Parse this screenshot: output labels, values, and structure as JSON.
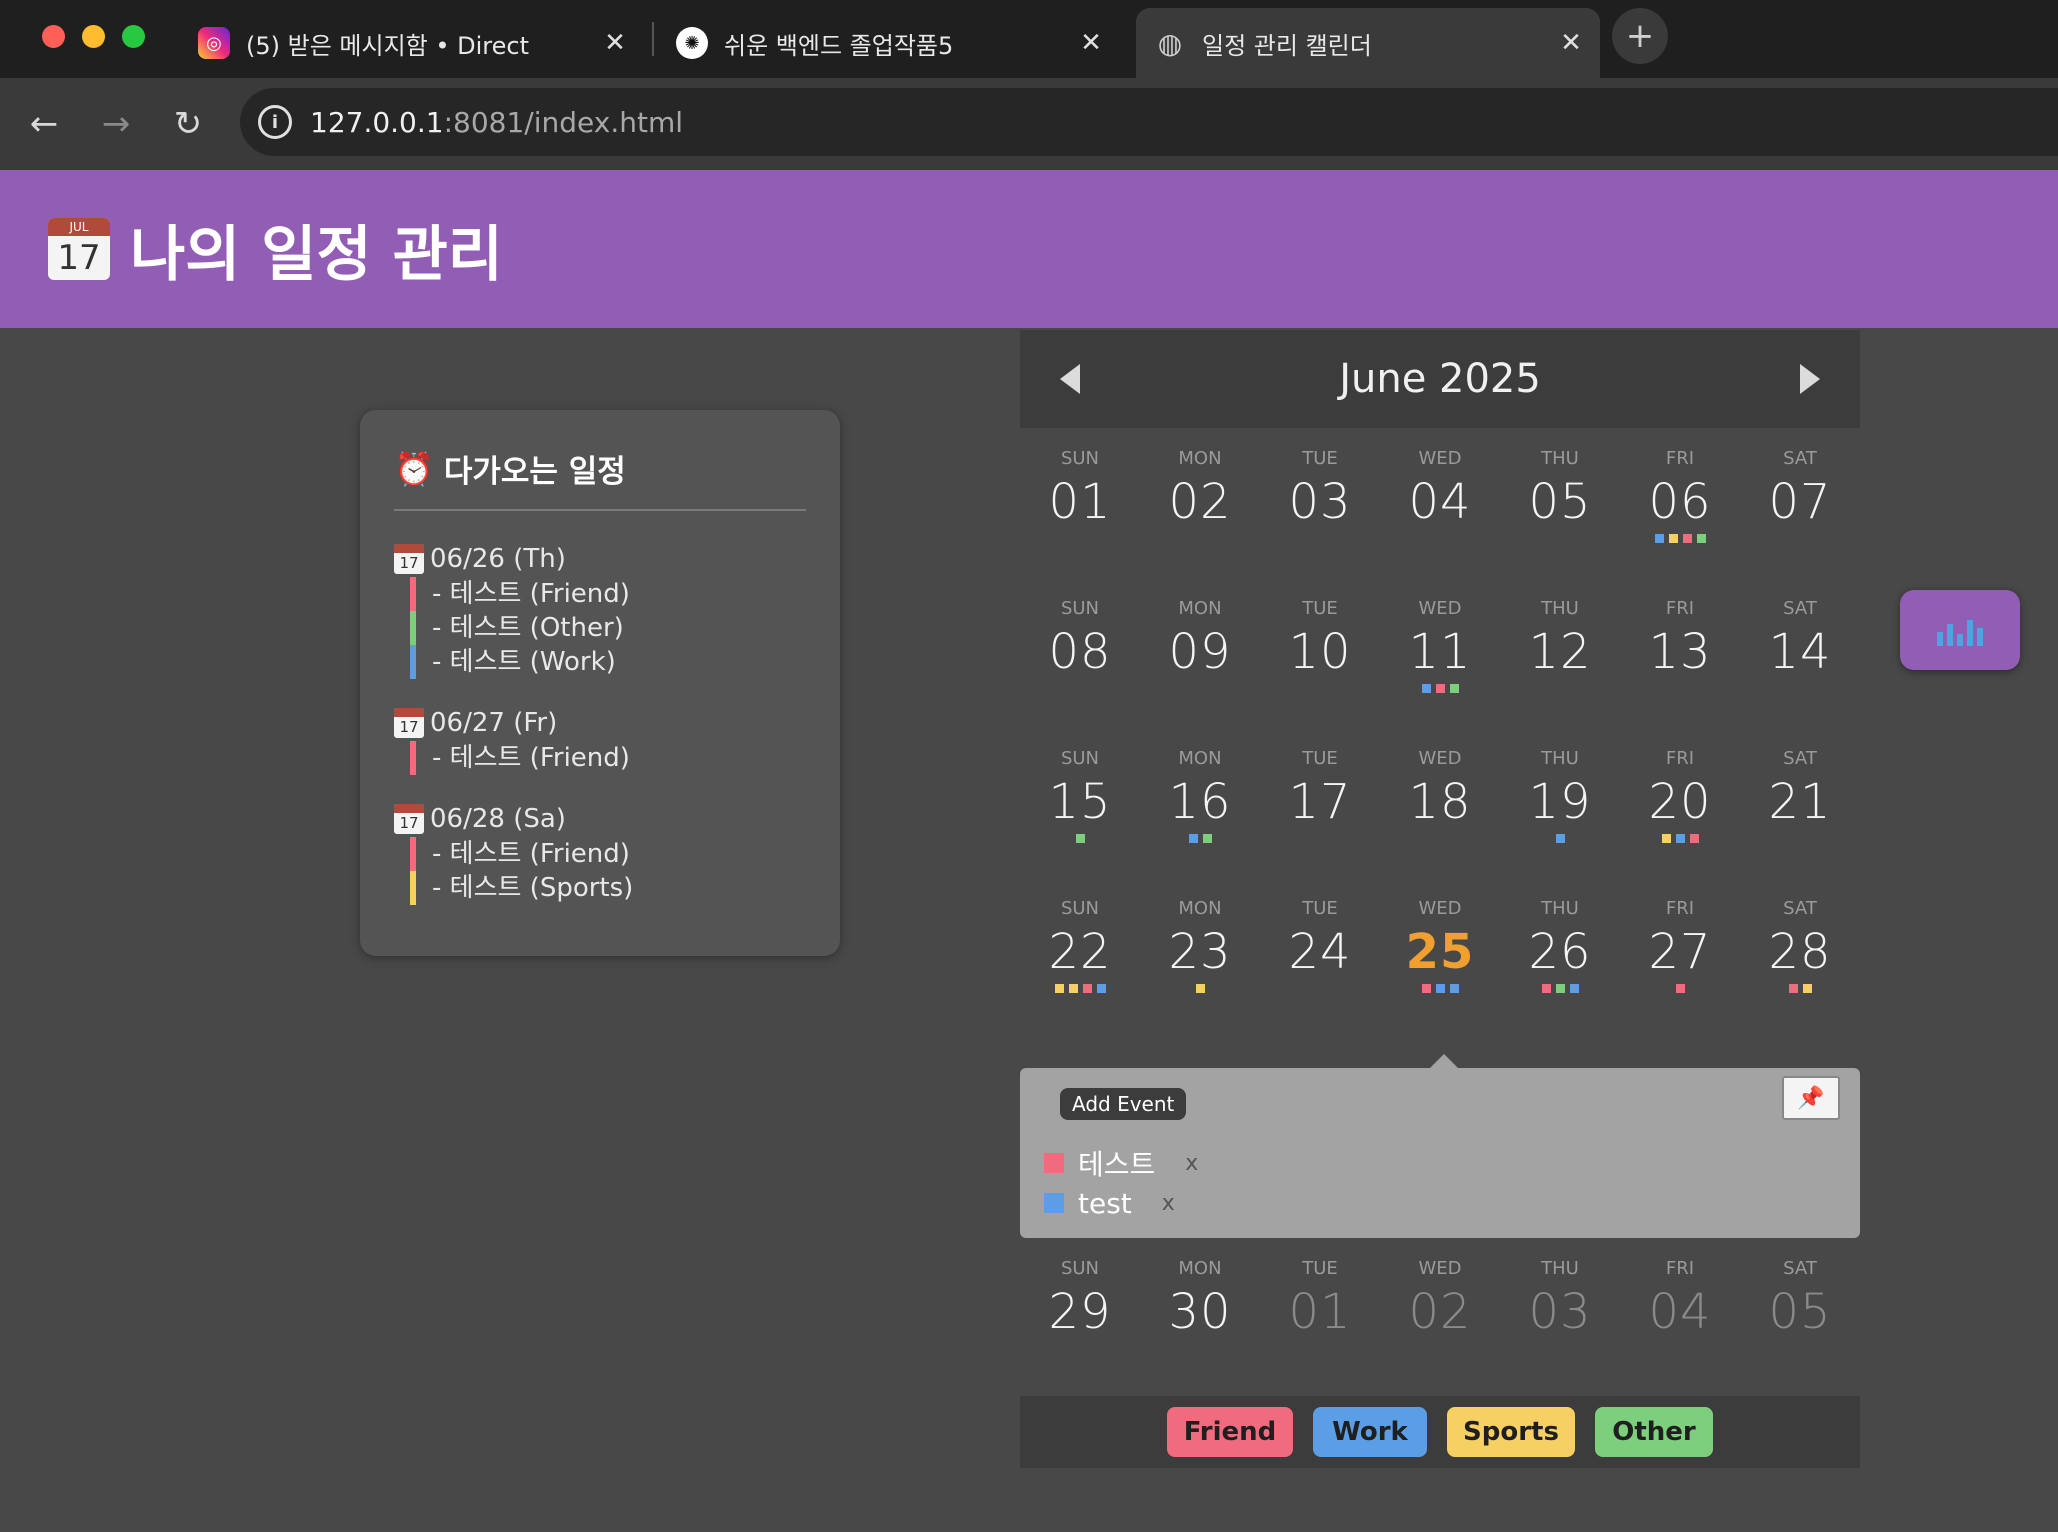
{
  "browser": {
    "tabs": [
      {
        "title": "(5) 받은 메시지함 • Direct",
        "icon": "instagram-icon",
        "close": "✕"
      },
      {
        "title": "쉬운 백엔드 졸업작품5",
        "icon": "chatgpt-icon",
        "close": "✕"
      },
      {
        "title": "일정 관리 캘린더",
        "icon": "globe-icon",
        "close": "✕"
      }
    ],
    "new_tab": "+",
    "url_host": "127.0.0.1",
    "url_path": ":8081/index.html"
  },
  "header": {
    "icon_month": "JUL",
    "icon_day": "17",
    "title": "나의 일정 관리"
  },
  "upcoming": {
    "title": "다가오는 일정",
    "groups": [
      {
        "date": "06/26 (Th)",
        "items": [
          {
            "text": "- 테스트 (Friend)",
            "color": "#f06b7e"
          },
          {
            "text": "- 테스트 (Other)",
            "color": "#7dcf7d"
          },
          {
            "text": "- 테스트 (Work)",
            "color": "#5b9ee6"
          }
        ]
      },
      {
        "date": "06/27 (Fr)",
        "items": [
          {
            "text": "- 테스트 (Friend)",
            "color": "#f06b7e"
          }
        ]
      },
      {
        "date": "06/28 (Sa)",
        "items": [
          {
            "text": "- 테스트 (Friend)",
            "color": "#f06b7e"
          },
          {
            "text": "- 테스트 (Sports)",
            "color": "#f7d063"
          }
        ]
      }
    ]
  },
  "calendar": {
    "month": "June 2025",
    "weeks": [
      [
        {
          "n": "SUN",
          "d": "01",
          "dots": []
        },
        {
          "n": "MON",
          "d": "02",
          "dots": []
        },
        {
          "n": "TUE",
          "d": "03",
          "dots": []
        },
        {
          "n": "WED",
          "d": "04",
          "dots": []
        },
        {
          "n": "THU",
          "d": "05",
          "dots": []
        },
        {
          "n": "FRI",
          "d": "06",
          "dots": [
            "#5b9ee6",
            "#f7d063",
            "#f06b7e",
            "#7dcf7d"
          ]
        },
        {
          "n": "SAT",
          "d": "07",
          "dots": []
        }
      ],
      [
        {
          "n": "SUN",
          "d": "08",
          "dots": []
        },
        {
          "n": "MON",
          "d": "09",
          "dots": []
        },
        {
          "n": "TUE",
          "d": "10",
          "dots": []
        },
        {
          "n": "WED",
          "d": "11",
          "dots": [
            "#5b9ee6",
            "#f06b7e",
            "#7dcf7d"
          ]
        },
        {
          "n": "THU",
          "d": "12",
          "dots": []
        },
        {
          "n": "FRI",
          "d": "13",
          "dots": []
        },
        {
          "n": "SAT",
          "d": "14",
          "dots": []
        }
      ],
      [
        {
          "n": "SUN",
          "d": "15",
          "dots": [
            "#7dcf7d"
          ]
        },
        {
          "n": "MON",
          "d": "16",
          "dots": [
            "#5b9ee6",
            "#7dcf7d"
          ]
        },
        {
          "n": "TUE",
          "d": "17",
          "dots": []
        },
        {
          "n": "WED",
          "d": "18",
          "dots": []
        },
        {
          "n": "THU",
          "d": "19",
          "dots": [
            "#5b9ee6"
          ]
        },
        {
          "n": "FRI",
          "d": "20",
          "dots": [
            "#f7d063",
            "#5b9ee6",
            "#f06b7e"
          ]
        },
        {
          "n": "SAT",
          "d": "21",
          "dots": []
        }
      ],
      [
        {
          "n": "SUN",
          "d": "22",
          "dots": [
            "#f7d063",
            "#f7d063",
            "#f06b7e",
            "#5b9ee6"
          ]
        },
        {
          "n": "MON",
          "d": "23",
          "dots": [
            "#f7d063"
          ]
        },
        {
          "n": "TUE",
          "d": "24",
          "dots": []
        },
        {
          "n": "WED",
          "d": "25",
          "dots": [
            "#f06b7e",
            "#5b9ee6",
            "#5b9ee6"
          ],
          "today": true
        },
        {
          "n": "THU",
          "d": "26",
          "dots": [
            "#f06b7e",
            "#7dcf7d",
            "#5b9ee6"
          ]
        },
        {
          "n": "FRI",
          "d": "27",
          "dots": [
            "#f06b7e"
          ]
        },
        {
          "n": "SAT",
          "d": "28",
          "dots": [
            "#f06b7e",
            "#f7d063"
          ]
        }
      ],
      [
        {
          "n": "SUN",
          "d": "29",
          "dots": []
        },
        {
          "n": "MON",
          "d": "30",
          "dots": []
        },
        {
          "n": "TUE",
          "d": "01",
          "dots": [],
          "other": true
        },
        {
          "n": "WED",
          "d": "02",
          "dots": [],
          "other": true
        },
        {
          "n": "THU",
          "d": "03",
          "dots": [],
          "other": true
        },
        {
          "n": "FRI",
          "d": "04",
          "dots": [],
          "other": true
        },
        {
          "n": "SAT",
          "d": "05",
          "dots": [],
          "other": true
        }
      ]
    ],
    "popup": {
      "add_label": "Add Event",
      "pin_icon": "pushpin-icon",
      "events": [
        {
          "title": "테스트",
          "color": "#f06b7e",
          "remove": "x"
        },
        {
          "title": "test",
          "color": "#5b9ee6",
          "remove": "x"
        }
      ]
    },
    "legend": [
      {
        "label": "Friend",
        "color": "#f06b7e"
      },
      {
        "label": "Work",
        "color": "#5b9ee6"
      },
      {
        "label": "Sports",
        "color": "#f7d063"
      },
      {
        "label": "Other",
        "color": "#7dcf7d"
      }
    ]
  },
  "fab": {
    "icon": "chart-icon"
  }
}
